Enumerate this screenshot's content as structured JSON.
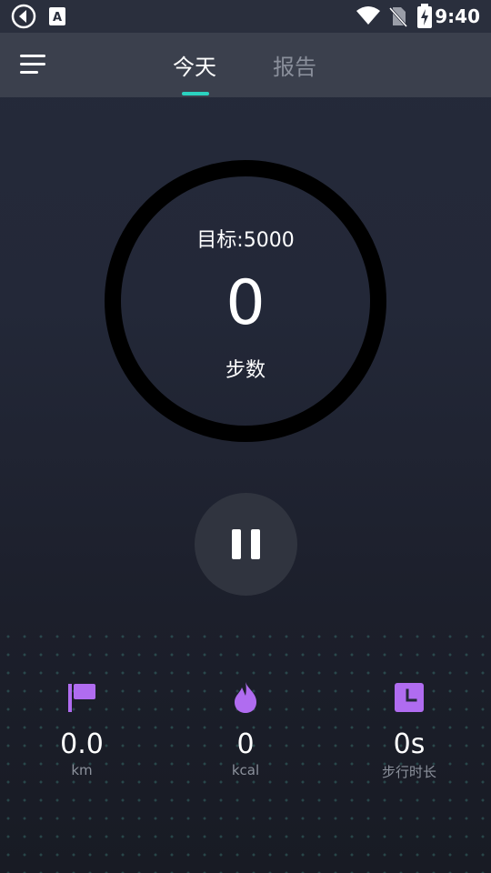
{
  "status_bar": {
    "time": "9:40",
    "icons": [
      "app-icon",
      "keyboard-icon",
      "wifi-icon",
      "no-sim-icon",
      "battery-charging-icon"
    ]
  },
  "header": {
    "menu_icon": "hamburger-menu-icon",
    "tabs": [
      {
        "label": "今天",
        "active": true
      },
      {
        "label": "报告",
        "active": false
      }
    ],
    "accent": "#2bd2c0"
  },
  "progress": {
    "goal_text": "目标:5000",
    "steps": "0",
    "steps_label": "步数",
    "fraction": 0
  },
  "controls": {
    "pause_icon": "pause-icon"
  },
  "stats": [
    {
      "icon": "flag-icon",
      "value": "0.0",
      "unit": "km"
    },
    {
      "icon": "flame-icon",
      "value": "0",
      "unit": "kcal"
    },
    {
      "icon": "clock-icon",
      "value": "0s",
      "unit": "步行时长"
    }
  ],
  "colors": {
    "stat_icon": "#b06cf0",
    "background": "#232838",
    "ring": "#000000"
  }
}
